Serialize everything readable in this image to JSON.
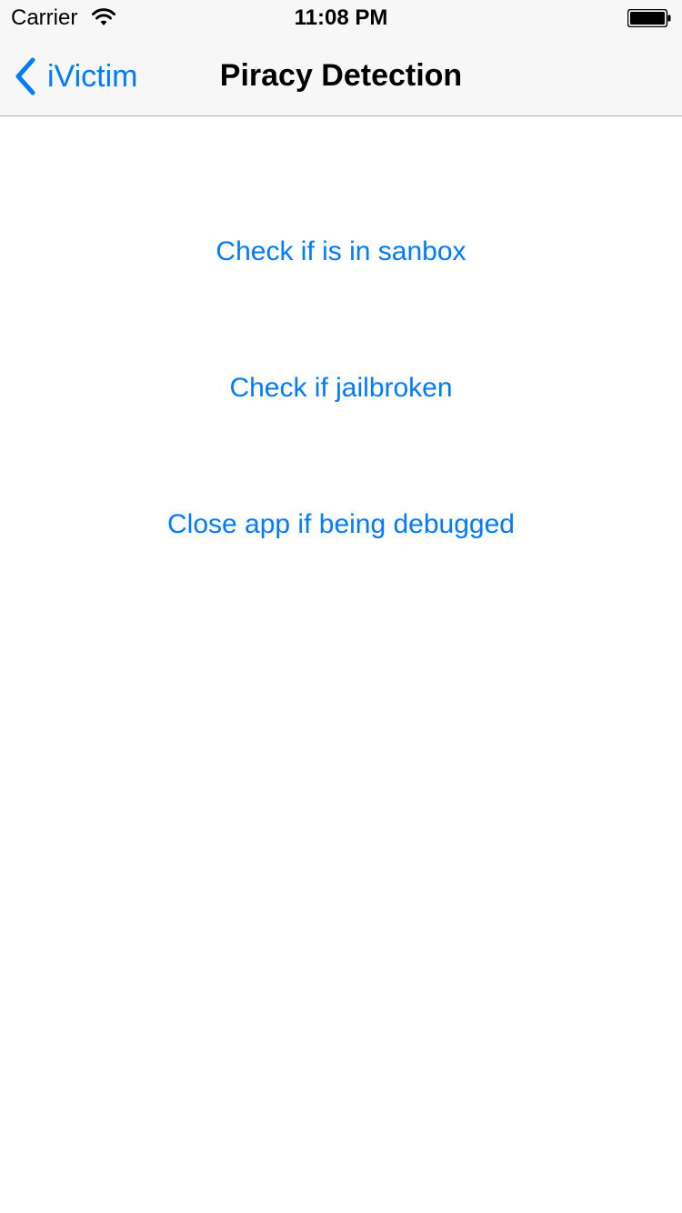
{
  "status_bar": {
    "carrier": "Carrier",
    "time": "11:08 PM",
    "wifi_icon": "wifi-icon",
    "battery_icon": "battery-icon"
  },
  "nav_bar": {
    "back_label": "iVictim",
    "title": "Piracy Detection",
    "back_icon": "chevron-left-icon"
  },
  "actions": [
    {
      "label": "Check if is in sanbox"
    },
    {
      "label": "Check if jailbroken"
    },
    {
      "label": "Close app if being debugged"
    }
  ],
  "colors": {
    "accent": "#007aff",
    "navbar_bg": "#f7f7f7"
  }
}
